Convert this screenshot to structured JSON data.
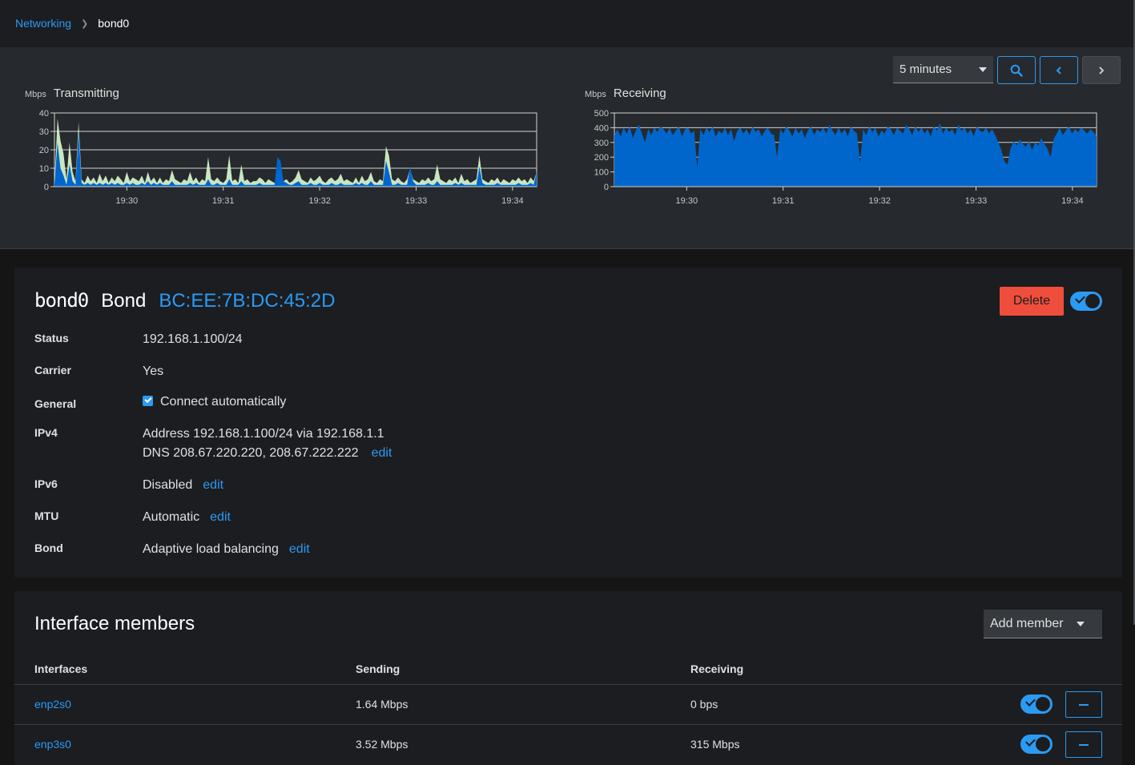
{
  "breadcrumb": {
    "parent": "Networking",
    "current": "bond0"
  },
  "controls": {
    "range": "5 minutes"
  },
  "charts": {
    "tx": {
      "unit": "Mbps",
      "title": "Transmitting"
    },
    "rx": {
      "unit": "Mbps",
      "title": "Receiving"
    }
  },
  "chart_data": [
    {
      "type": "area",
      "title": "Transmitting",
      "ylabel": "Mbps",
      "ylim": [
        0,
        40
      ],
      "yticks": [
        0,
        10,
        20,
        30,
        40
      ],
      "xticks": [
        "19:30",
        "19:31",
        "19:32",
        "19:33",
        "19:34"
      ],
      "grid": true,
      "series": [
        {
          "color": "#c8e6c0",
          "values": [
            2,
            37,
            25,
            18,
            4,
            24,
            8,
            3,
            35,
            4,
            2,
            6,
            3,
            5,
            2,
            7,
            3,
            6,
            2,
            5,
            3,
            6,
            4,
            2,
            8,
            3,
            5,
            4,
            3,
            6,
            2,
            8,
            3,
            5,
            2,
            5,
            2,
            4,
            3,
            9,
            4,
            3,
            2,
            4,
            3,
            8,
            3,
            5,
            2,
            4,
            3,
            16,
            4,
            3,
            5,
            3,
            2,
            4,
            17,
            3,
            4,
            2,
            12,
            3,
            4,
            2,
            3,
            3,
            5,
            4,
            2,
            4,
            3,
            2,
            5,
            8,
            3,
            4,
            2,
            3,
            5,
            9,
            4,
            3,
            2,
            5,
            3,
            4,
            6,
            3,
            2,
            4,
            5,
            3,
            4,
            7,
            3,
            4,
            3,
            2,
            5,
            2,
            6,
            3,
            4,
            8,
            3,
            2,
            4,
            3,
            22,
            17,
            4,
            3,
            5,
            3,
            2,
            4,
            10,
            4,
            3,
            2,
            4,
            3,
            5,
            3,
            4,
            12,
            4,
            3,
            2,
            4,
            3,
            5,
            2,
            7,
            3,
            4,
            2,
            3,
            4,
            17,
            4,
            3,
            2,
            4,
            3,
            5,
            2,
            4,
            3,
            2,
            4,
            3,
            5,
            3,
            4,
            2,
            5,
            3,
            8
          ]
        },
        {
          "color": "#0066cc",
          "values": [
            1,
            24,
            10,
            6,
            1,
            12,
            3,
            1,
            30,
            2,
            1,
            2,
            1,
            2,
            1,
            2,
            1,
            2,
            1,
            2,
            1,
            2,
            1,
            1,
            2,
            1,
            2,
            1,
            1,
            2,
            1,
            3,
            1,
            2,
            1,
            2,
            1,
            1,
            1,
            3,
            1,
            1,
            1,
            1,
            1,
            2,
            1,
            2,
            1,
            1,
            1,
            4,
            1,
            1,
            2,
            1,
            1,
            1,
            4,
            1,
            1,
            1,
            3,
            1,
            1,
            1,
            1,
            1,
            2,
            1,
            1,
            1,
            1,
            1,
            16,
            14,
            3,
            2,
            1,
            1,
            2,
            3,
            1,
            1,
            1,
            2,
            1,
            1,
            2,
            1,
            1,
            1,
            2,
            1,
            1,
            2,
            1,
            1,
            1,
            1,
            2,
            1,
            2,
            1,
            1,
            3,
            1,
            1,
            1,
            1,
            14,
            8,
            1,
            1,
            2,
            1,
            1,
            1,
            11,
            3,
            1,
            1,
            1,
            1,
            2,
            1,
            1,
            3,
            1,
            1,
            1,
            1,
            1,
            2,
            1,
            2,
            1,
            1,
            1,
            1,
            1,
            11,
            2,
            1,
            1,
            1,
            1,
            2,
            1,
            1,
            1,
            1,
            1,
            1,
            2,
            1,
            1,
            1,
            2,
            1,
            8
          ]
        }
      ]
    },
    {
      "type": "area",
      "title": "Receiving",
      "ylabel": "Mbps",
      "ylim": [
        0,
        500
      ],
      "yticks": [
        0,
        100,
        200,
        300,
        400,
        500
      ],
      "xticks": [
        "19:30",
        "19:31",
        "19:32",
        "19:33",
        "19:34"
      ],
      "grid": true,
      "series": [
        {
          "color": "#0066cc",
          "values": [
            350,
            390,
            340,
            400,
            360,
            410,
            330,
            380,
            420,
            360,
            300,
            390,
            350,
            400,
            370,
            410,
            390,
            360,
            400,
            350,
            380,
            410,
            340,
            390,
            400,
            360,
            380,
            130,
            390,
            350,
            400,
            370,
            410,
            340,
            380,
            360,
            400,
            350,
            390,
            310,
            380,
            400,
            360,
            390,
            350,
            410,
            370,
            390,
            340,
            380,
            400,
            360,
            350,
            200,
            390,
            360,
            410,
            380,
            340,
            400,
            360,
            390,
            330,
            380,
            410,
            350,
            390,
            370,
            400,
            360,
            420,
            380,
            350,
            400,
            360,
            390,
            340,
            410,
            380,
            360,
            160,
            390,
            350,
            410,
            370,
            400,
            340,
            380,
            360,
            410,
            390,
            350,
            400,
            380,
            360,
            420,
            390,
            350,
            410,
            370,
            400,
            360,
            390,
            340,
            410,
            380,
            430,
            360,
            400,
            370,
            390,
            350,
            420,
            380,
            400,
            360,
            390,
            340,
            410,
            380,
            370,
            400,
            360,
            390,
            350,
            300,
            250,
            170,
            150,
            260,
            310,
            280,
            320,
            290,
            270,
            310,
            250,
            300,
            280,
            330,
            290,
            260,
            200,
            320,
            360,
            400,
            350,
            380,
            410,
            360,
            390,
            370,
            400,
            380,
            360,
            390,
            370,
            340
          ]
        }
      ]
    }
  ],
  "device": {
    "name": "bond0",
    "type": "Bond",
    "mac": "BC:EE:7B:DC:45:2D",
    "delete_label": "Delete",
    "enabled": true
  },
  "properties": [
    {
      "label": "Status",
      "value": "192.168.1.100/24"
    },
    {
      "label": "Carrier",
      "value": "Yes"
    },
    {
      "label": "General",
      "value": "Connect automatically",
      "checked": true
    },
    {
      "label": "IPv4",
      "value": "Address 192.168.1.100/24 via 192.168.1.1",
      "value2": "DNS 208.67.220.220, 208.67.222.222",
      "edit": "edit"
    },
    {
      "label": "IPv6",
      "value": "Disabled",
      "edit": "edit"
    },
    {
      "label": "MTU",
      "value": "Automatic",
      "edit": "edit"
    },
    {
      "label": "Bond",
      "value": "Adaptive load balancing",
      "edit": "edit"
    }
  ],
  "members": {
    "title": "Interface members",
    "add_label": "Add member",
    "columns": [
      "Interfaces",
      "Sending",
      "Receiving"
    ],
    "rows": [
      {
        "name": "enp2s0",
        "sending": "1.64 Mbps",
        "receiving": "0 bps",
        "enabled": true
      },
      {
        "name": "enp3s0",
        "sending": "3.52 Mbps",
        "receiving": "315 Mbps",
        "enabled": true
      }
    ]
  },
  "colors": {
    "accent": "#2b9af3",
    "danger": "#ef4e3c",
    "tx_fill": "#c8e6c0",
    "series_fill": "#0066cc"
  }
}
